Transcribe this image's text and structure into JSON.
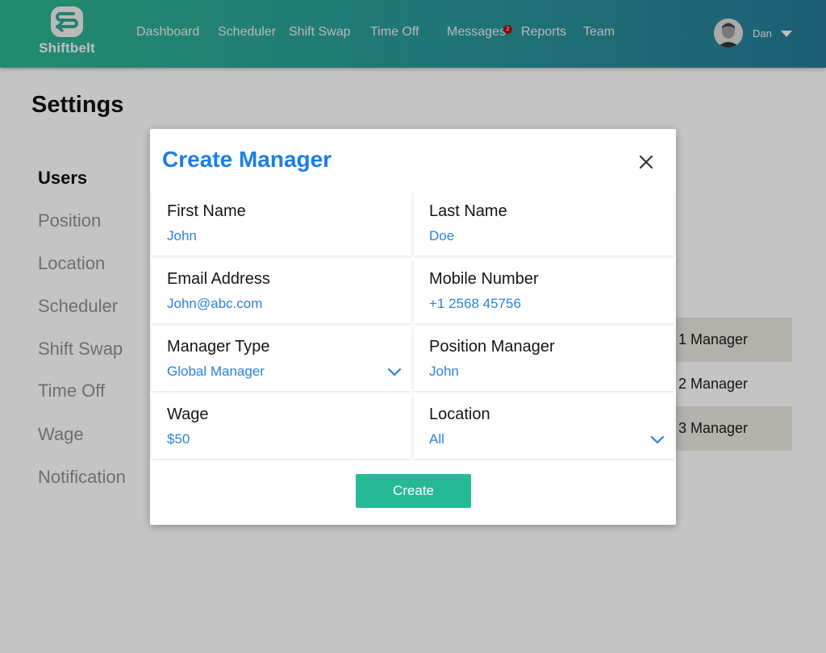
{
  "app": {
    "name": "Shiftbelt"
  },
  "nav": {
    "items": [
      {
        "id": "dashboard",
        "label": "Dashboard"
      },
      {
        "id": "scheduler",
        "label": "Scheduler"
      },
      {
        "id": "shift-swap",
        "label": "Shift Swap"
      },
      {
        "id": "time-off",
        "label": "Time Off"
      },
      {
        "id": "messages",
        "label": "Messages"
      },
      {
        "id": "reports",
        "label": "Reports"
      },
      {
        "id": "team",
        "label": "Team"
      }
    ],
    "messages_badge": "2",
    "user_name": "Dan"
  },
  "page": {
    "title": "Settings",
    "sidebar": [
      "Users",
      "Position",
      "Location",
      "Scheduler",
      "Shift Swap",
      "Time Off",
      "Wage",
      "Notification"
    ],
    "sidebar_active": "Users",
    "background_rows": [
      "1 Manager",
      "2 Manager",
      "3 Manager"
    ]
  },
  "modal": {
    "title": "Create Manager",
    "fields": {
      "first_name": {
        "label": "First Name",
        "value": "John"
      },
      "last_name": {
        "label": "Last Name",
        "value": "Doe"
      },
      "email": {
        "label": "Email Address",
        "value": "John@abc.com"
      },
      "mobile": {
        "label": "Mobile Number",
        "value": "+1 2568 45756"
      },
      "manager_type": {
        "label": "Manager Type",
        "value": "Global Manager"
      },
      "position_manager": {
        "label": "Position Manager",
        "value": "John"
      },
      "wage": {
        "label": "Wage",
        "value": "$50"
      },
      "location": {
        "label": "Location",
        "value": "All"
      }
    },
    "create_label": "Create"
  },
  "colors": {
    "accent_blue": "#1b7ee6",
    "value_blue": "#2a82dc",
    "create_green": "#26b996",
    "badge_red": "#9c1010"
  },
  "icons": [
    "logo-s-icon",
    "avatar",
    "caret-down-icon",
    "close-icon",
    "chevron-down-icon"
  ]
}
